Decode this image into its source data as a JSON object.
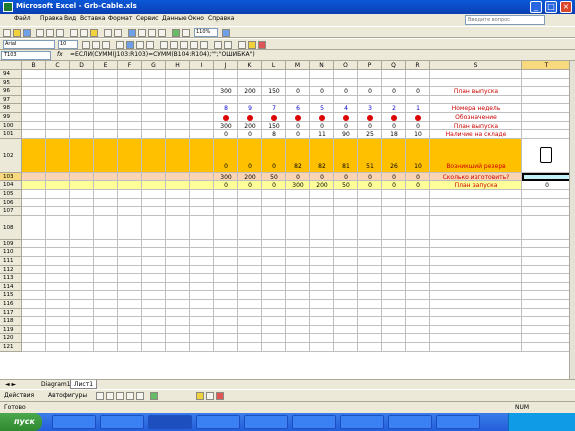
{
  "window": {
    "title": "Microsoft Excel - Grb-Cable.xls"
  },
  "menu": [
    "Файл",
    "Правка",
    "Вид",
    "Вставка",
    "Формат",
    "Сервис",
    "Данные",
    "Окно",
    "Справка"
  ],
  "help_placeholder": "Введите вопрос",
  "toolbar": {
    "zoom": "110%",
    "font": "Arial",
    "size": "10"
  },
  "formula_bar": {
    "cell_ref": "T103",
    "fx": "fx",
    "formula": "=ЕСЛИ(СУММ(J103:R103)=СУММ(B104:R104);\"\";\"ОШИБКА\")"
  },
  "columns": [
    "B",
    "C",
    "D",
    "E",
    "F",
    "G",
    "H",
    "I",
    "J",
    "K",
    "L",
    "M",
    "N",
    "O",
    "P",
    "Q",
    "R",
    "S",
    "T"
  ],
  "rows": [
    {
      "n": "94",
      "h": "s",
      "vals": {}
    },
    {
      "n": "95",
      "h": "s",
      "vals": {}
    },
    {
      "n": "96",
      "h": "s",
      "vals": {
        "J": "300",
        "K": "200",
        "L": "150",
        "M": "0",
        "N": "0",
        "O": "0",
        "P": "0",
        "Q": "0",
        "R": "0",
        "S": "План выпуска"
      }
    },
    {
      "n": "97",
      "h": "s",
      "vals": {}
    },
    {
      "n": "98",
      "h": "s",
      "vals": {
        "J": "8",
        "K": "9",
        "L": "7",
        "M": "6",
        "N": "5",
        "O": "4",
        "P": "3",
        "Q": "2",
        "R": "1",
        "S": "Номера недель"
      }
    },
    {
      "n": "99",
      "h": "s",
      "dots": true,
      "vals": {
        "S": "Обозначение"
      }
    },
    {
      "n": "100",
      "h": "s",
      "vals": {
        "J": "300",
        "K": "200",
        "L": "150",
        "M": "0",
        "N": "0",
        "O": "0",
        "P": "0",
        "Q": "0",
        "R": "0",
        "S": "План выпуска"
      }
    },
    {
      "n": "101",
      "h": "s",
      "vals": {
        "J": "0",
        "K": "0",
        "L": "8",
        "M": "0",
        "N": "11",
        "O": "90",
        "P": "25",
        "Q": "18",
        "R": "10",
        "S": "Наличие на складе"
      }
    },
    {
      "n": "102",
      "h": "l",
      "orange": true,
      "vals": {
        "J": "0",
        "K": "0",
        "L": "0",
        "M": "82",
        "N": "82",
        "O": "81",
        "P": "51",
        "Q": "26",
        "R": "10",
        "S": "Возникший резерв"
      }
    },
    {
      "n": "103",
      "h": "s",
      "peach": true,
      "vals": {
        "J": "300",
        "K": "200",
        "L": "50",
        "M": "0",
        "N": "0",
        "O": "0",
        "P": "0",
        "Q": "0",
        "R": "0",
        "S": "Сколько изготовить?"
      }
    },
    {
      "n": "104",
      "h": "s",
      "yellow": true,
      "vals": {
        "J": "0",
        "K": "0",
        "L": "0",
        "M": "300",
        "N": "200",
        "O": "50",
        "P": "0",
        "Q": "0",
        "R": "0",
        "S": "План запуска",
        "T": "0"
      }
    },
    {
      "n": "105",
      "h": "s",
      "vals": {}
    },
    {
      "n": "106",
      "h": "s",
      "vals": {}
    },
    {
      "n": "107",
      "h": "s",
      "vals": {}
    },
    {
      "n": "108",
      "h": "m",
      "vals": {}
    },
    {
      "n": "109",
      "h": "s",
      "vals": {}
    },
    {
      "n": "110",
      "h": "s",
      "vals": {}
    },
    {
      "n": "111",
      "h": "s",
      "vals": {}
    },
    {
      "n": "112",
      "h": "s",
      "vals": {}
    },
    {
      "n": "113",
      "h": "s",
      "vals": {}
    },
    {
      "n": "114",
      "h": "s",
      "vals": {}
    },
    {
      "n": "115",
      "h": "s",
      "vals": {}
    },
    {
      "n": "116",
      "h": "s",
      "vals": {}
    },
    {
      "n": "117",
      "h": "s",
      "vals": {}
    },
    {
      "n": "118",
      "h": "s",
      "vals": {}
    },
    {
      "n": "119",
      "h": "s",
      "vals": {}
    },
    {
      "n": "120",
      "h": "s",
      "vals": {}
    },
    {
      "n": "121",
      "h": "s",
      "vals": {}
    }
  ],
  "sheet_tabs": [
    "Diagram1",
    "Лист1"
  ],
  "drawing": {
    "actions": "Действия",
    "autoshapes": "Автофигуры"
  },
  "status": {
    "left": "Готово",
    "right": "NUM"
  },
  "taskbar": {
    "start": "пуск"
  },
  "colors": {
    "orange": "#ffc000",
    "peach": "#fbd4b4",
    "yellow": "#ffff99",
    "red_text": "#cc0000",
    "blue_text": "#0000cc"
  }
}
